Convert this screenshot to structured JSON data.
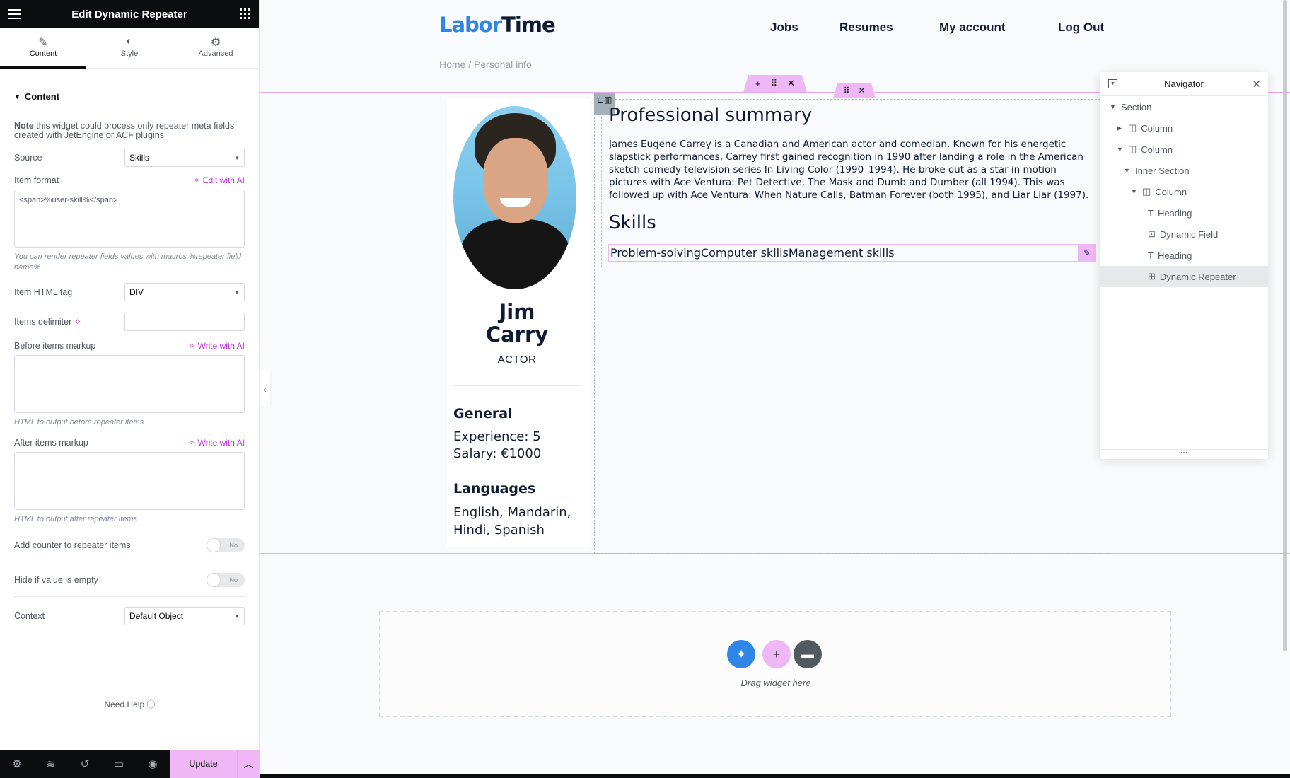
{
  "panel": {
    "title": "Edit Dynamic Repeater",
    "tabs": [
      {
        "label": "Content",
        "icon": "pencil-icon",
        "active": true
      },
      {
        "label": "Style",
        "icon": "half-circle-icon",
        "active": false
      },
      {
        "label": "Advanced",
        "icon": "gear-icon",
        "active": false
      }
    ],
    "section_title": "Content",
    "note_bold": "Note",
    "note_text": " this widget could process only repeater meta fields created with JetEngine or ACF plugins",
    "source": {
      "label": "Source",
      "value": "Skills"
    },
    "item_format": {
      "label": "Item format",
      "ai_label": "Edit with AI",
      "value": "<span>%user-skill%</span>",
      "hint": "You can render repeater fields values with macros %repeater field name%"
    },
    "item_html_tag": {
      "label": "Item HTML tag",
      "value": "DIV"
    },
    "items_delimiter": {
      "label": "Items delimiter",
      "value": ""
    },
    "before_markup": {
      "label": "Before items markup",
      "ai_label": "Write with AI",
      "value": "",
      "hint": "HTML to output before repeater items"
    },
    "after_markup": {
      "label": "After items markup",
      "ai_label": "Write with AI",
      "value": "",
      "hint": "HTML to output after repeater items"
    },
    "add_counter": {
      "label": "Add counter to repeater items",
      "state": "No"
    },
    "hide_empty": {
      "label": "Hide if value is empty",
      "state": "No"
    },
    "context": {
      "label": "Context",
      "value": "Default Object"
    },
    "help": "Need Help",
    "footer": {
      "update": "Update"
    }
  },
  "site": {
    "logo_part1": "Labor",
    "logo_part2": "Time",
    "nav": [
      "Jobs",
      "Resumes",
      "My account",
      "Log Out"
    ],
    "breadcrumb": "Home / Personal info"
  },
  "profile": {
    "first_name": "Jim",
    "last_name": "Carry",
    "role": "ACTOR",
    "general_title": "General",
    "experience": "Experience: 5",
    "salary": "Salary: €1000",
    "languages_title": "Languages",
    "languages_line1": "English, Mandarin,",
    "languages_line2": "Hindi, Spanish",
    "summary_title": "Professional summary",
    "summary": "James Eugene Carrey is a Canadian and American actor and comedian. Known for his energetic slapstick performances, Carrey first gained recognition in 1990 after landing a role in the American sketch comedy television series In Living Color (1990–1994). He broke out as a star in motion pictures with Ace Ventura: Pet Detective, The Mask and Dumb and Dumber (all 1994). This was followed up with Ace Ventura: When Nature Calls, Batman Forever (both 1995), and Liar Liar (1997).",
    "skills_title": "Skills",
    "skills": [
      "Problem-solving",
      "Computer skills",
      "Management skills"
    ]
  },
  "navigator": {
    "title": "Navigator",
    "items": [
      {
        "label": "Section",
        "caret": "down",
        "icon": ""
      },
      {
        "label": "Column",
        "caret": "right",
        "icon": "column-icon"
      },
      {
        "label": "Column",
        "caret": "down",
        "icon": "column-icon"
      },
      {
        "label": "Inner Section",
        "caret": "down",
        "icon": ""
      },
      {
        "label": "Column",
        "caret": "down",
        "icon": "column-icon"
      },
      {
        "label": "Heading",
        "caret": "",
        "icon": "heading-icon"
      },
      {
        "label": "Dynamic Field",
        "caret": "",
        "icon": "dynamic-field-icon"
      },
      {
        "label": "Heading",
        "caret": "",
        "icon": "heading-icon"
      },
      {
        "label": "Dynamic Repeater",
        "caret": "",
        "icon": "dynamic-repeater-icon",
        "active": true
      }
    ]
  },
  "dropzone": {
    "text": "Drag widget here"
  },
  "colors": {
    "accent": "#f0b7f7",
    "ai": "#c036d8",
    "logo_blue": "#2f86e6",
    "dark": "#0c0d0e"
  }
}
